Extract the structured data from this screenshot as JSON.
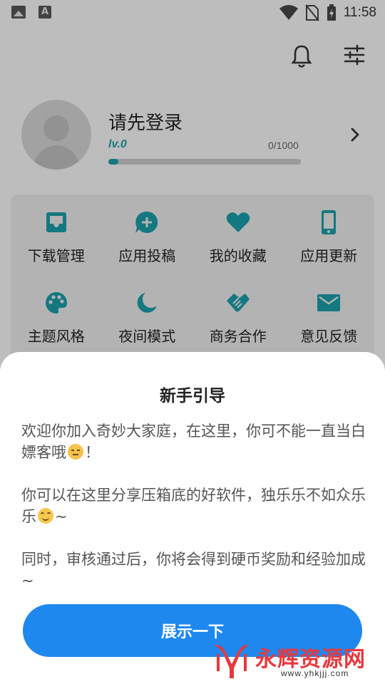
{
  "status_bar": {
    "time": "11:58",
    "left_icons": [
      "image-icon",
      "font-a-icon"
    ],
    "right_icons": [
      "wifi-icon",
      "no-sim-icon",
      "battery-charging-icon"
    ]
  },
  "top_actions": {
    "icons": [
      "bell-icon",
      "settings-sliders-icon"
    ]
  },
  "profile": {
    "title": "请先登录",
    "level": "lv.0",
    "exp_text": "0/1000",
    "exp_progress": 0.05
  },
  "grid": {
    "accent_color": "#1a9aa5",
    "items": [
      {
        "label": "下载管理",
        "icon": "inbox-icon"
      },
      {
        "label": "应用投稿",
        "icon": "chat-plus-icon"
      },
      {
        "label": "我的收藏",
        "icon": "heart-icon"
      },
      {
        "label": "应用更新",
        "icon": "phone-icon"
      },
      {
        "label": "主题风格",
        "icon": "palette-icon"
      },
      {
        "label": "夜间模式",
        "icon": "moon-icon"
      },
      {
        "label": "商务合作",
        "icon": "handshake-icon"
      },
      {
        "label": "意见反馈",
        "icon": "mail-icon"
      }
    ]
  },
  "sheet": {
    "title": "新手引导",
    "p1_text": "欢迎你加入奇妙大家庭，在这里，你可不能一直当白嫖客哦",
    "p1_end": "！",
    "p2_text": "你可以在这里分享压箱底的好软件，独乐乐不如众乐乐",
    "p2_end": "~",
    "p3_text": "同时，审核通过后，你将会得到硬币奖励和经验加成~",
    "button_label": "展示一下",
    "button_color": "#1e88ef"
  },
  "watermark": {
    "text": "永辉资源网",
    "url": "www.yhkjjj.com"
  }
}
